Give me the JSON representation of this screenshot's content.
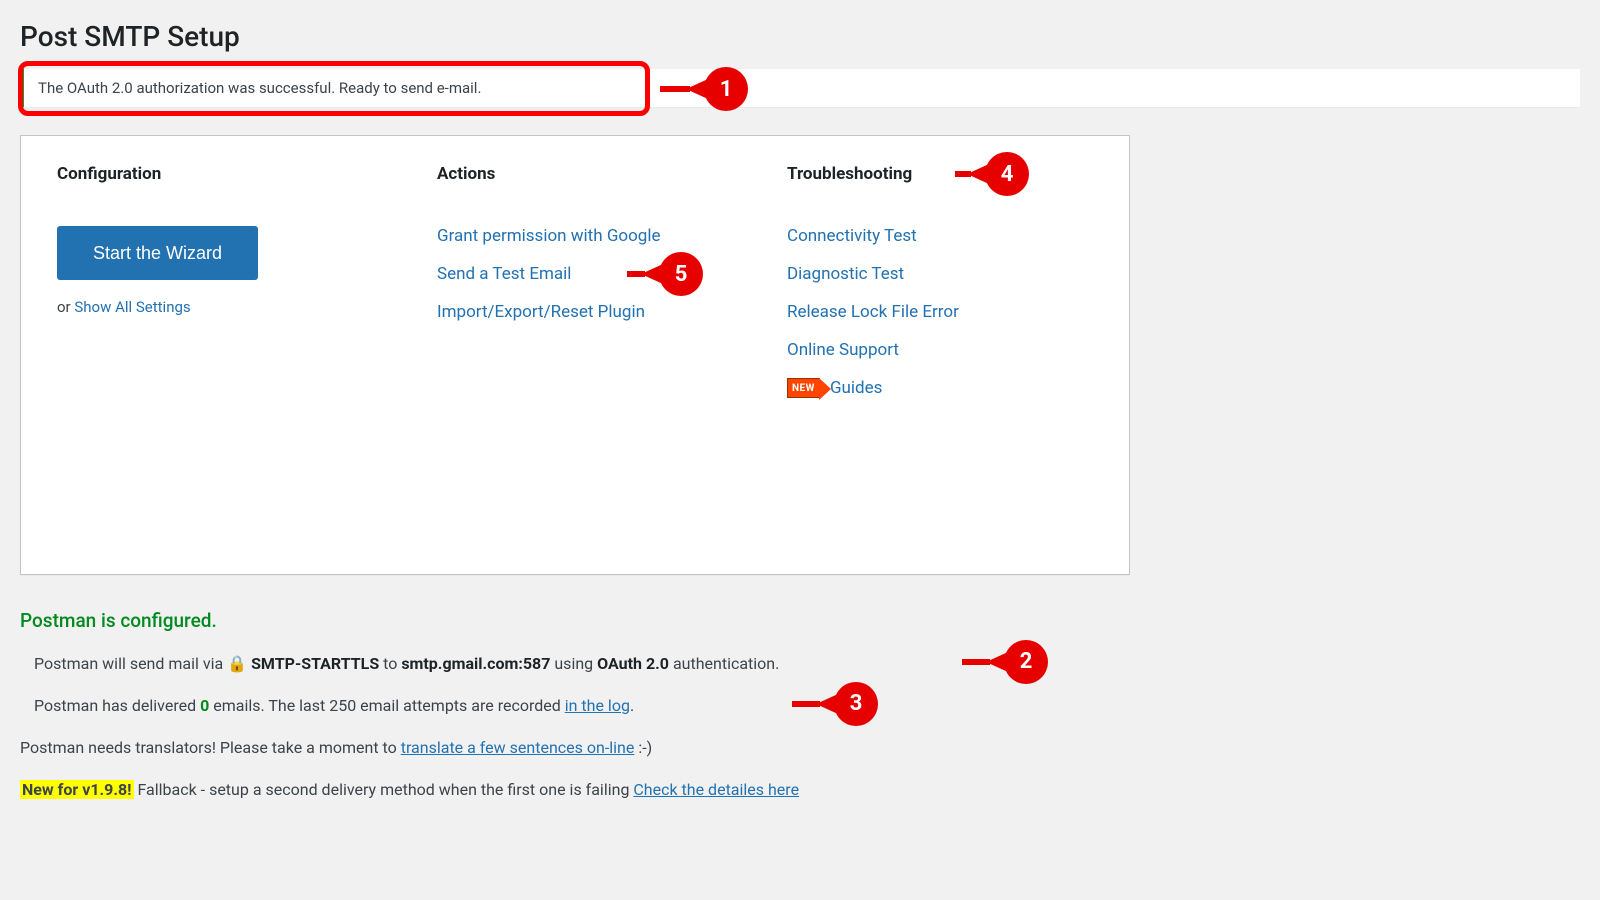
{
  "page": {
    "title": "Post SMTP Setup"
  },
  "notice": {
    "message": "The OAuth 2.0 authorization was successful. Ready to send e-mail."
  },
  "config": {
    "heading": "Configuration",
    "wizard_button": "Start the Wizard",
    "or_text": "or ",
    "show_all": "Show All Settings"
  },
  "actions": {
    "heading": "Actions",
    "items": [
      "Grant permission with Google",
      "Send a Test Email",
      "Import/Export/Reset Plugin"
    ]
  },
  "troubleshooting": {
    "heading": "Troubleshooting",
    "items": [
      "Connectivity Test",
      "Diagnostic Test",
      "Release Lock File Error",
      "Online Support"
    ],
    "new_badge": "NEW",
    "guides": "Guides"
  },
  "status": {
    "configured_heading": "Postman is configured.",
    "line1_prefix": "Postman will send mail via ",
    "line1_transport": "SMTP-STARTTLS",
    "line1_mid": " to ",
    "line1_host": "smtp.gmail.com:587",
    "line1_using": " using ",
    "line1_auth": "OAuth 2.0",
    "line1_suffix": " authentication.",
    "line2_prefix": "Postman has delivered ",
    "line2_count": "0",
    "line2_mid": " emails. The last 250 email attempts are recorded ",
    "line2_link": "in the log",
    "line2_suffix": "."
  },
  "notes": {
    "translators_prefix": "Postman needs translators! Please take a moment to ",
    "translators_link": "translate a few sentences on-line",
    "translators_suffix": " :-)",
    "new198_badge": "New for v1.9.8!",
    "new198_text": " Fallback - setup a second delivery method when the first one is failing ",
    "new198_link": "Check the detailes here"
  },
  "callouts": {
    "c1": "1",
    "c2": "2",
    "c3": "3",
    "c4": "4",
    "c5": "5"
  },
  "colors": {
    "link": "#2271b1",
    "accent_green": "#00a32a",
    "callout_red": "#e60000"
  }
}
